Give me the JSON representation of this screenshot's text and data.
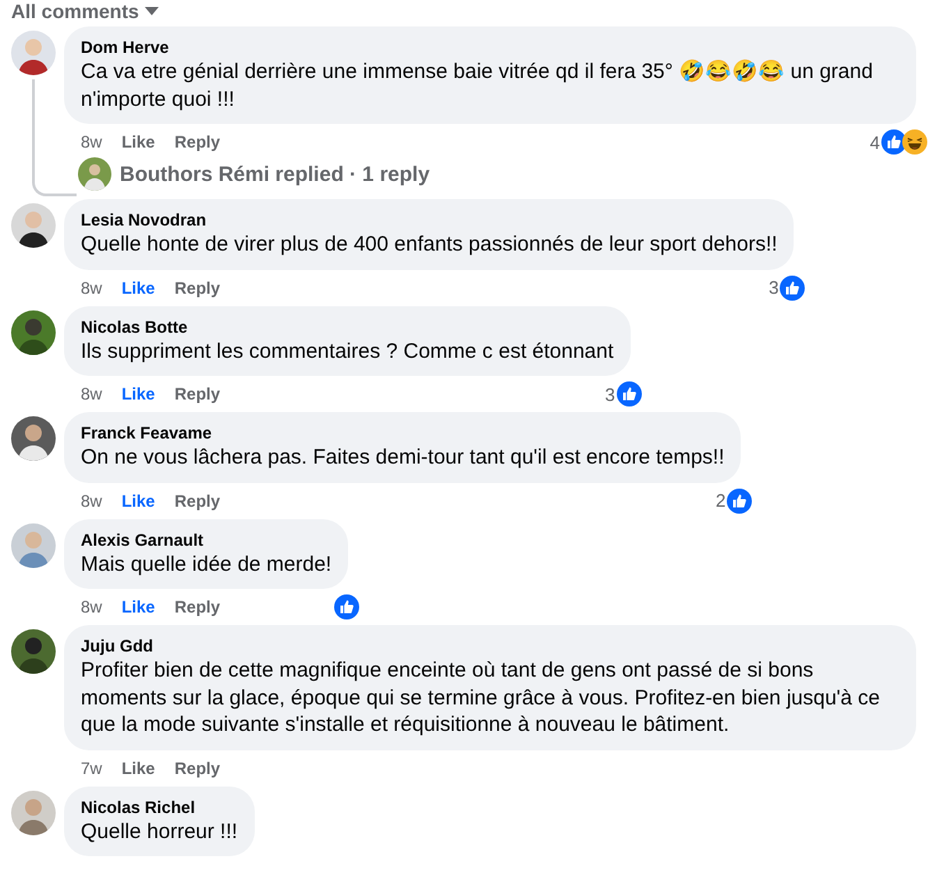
{
  "filter": {
    "label": "All comments"
  },
  "comments": [
    {
      "author": "Dom Herve",
      "text": "Ca va etre génial derrière une immense baie vitrée qd il fera 35° 🤣😂🤣😂 un grand n'importe quoi !!!",
      "time": "8w",
      "like": "Like",
      "reply": "Reply",
      "liked": false,
      "reaction_count": "4",
      "reactions": [
        {
          "kind": "like"
        },
        {
          "kind": "haha"
        }
      ],
      "replies": {
        "label": "Bouthors Rémi replied · 1 reply"
      }
    },
    {
      "author": "Lesia Novodran",
      "text": "Quelle honte de virer plus de 400 enfants passionnés de leur sport dehors!!",
      "time": "8w",
      "like": "Like",
      "reply": "Reply",
      "liked": true,
      "reaction_count": "3",
      "reactions": [
        {
          "kind": "like"
        }
      ]
    },
    {
      "author": "Nicolas Botte",
      "text": "Ils suppriment les commentaires ? Comme c est étonnant",
      "time": "8w",
      "like": "Like",
      "reply": "Reply",
      "liked": true,
      "reaction_count": "3",
      "reactions": [
        {
          "kind": "like"
        }
      ]
    },
    {
      "author": "Franck Feavame",
      "text": "On ne vous lâchera pas. Faites demi-tour tant qu'il est encore temps!!",
      "time": "8w",
      "like": "Like",
      "reply": "Reply",
      "liked": true,
      "reaction_count": "2",
      "reactions": [
        {
          "kind": "like"
        }
      ]
    },
    {
      "author": "Alexis Garnault",
      "text": "Mais quelle idée de merde!",
      "time": "8w",
      "like": "Like",
      "reply": "Reply",
      "liked": true,
      "reactions": [
        {
          "kind": "like"
        }
      ]
    },
    {
      "author": "Juju Gdd",
      "text": "Profiter bien de cette magnifique enceinte où tant de gens ont passé de si bons moments sur la glace, époque qui se termine grâce à vous. Profitez-en bien jusqu'à ce que la mode suivante s'installe et réquisitionne à nouveau le bâtiment.",
      "time": "7w",
      "like": "Like",
      "reply": "Reply",
      "liked": false
    },
    {
      "author": "Nicolas Richel",
      "text": "Quelle horreur !!!"
    }
  ]
}
